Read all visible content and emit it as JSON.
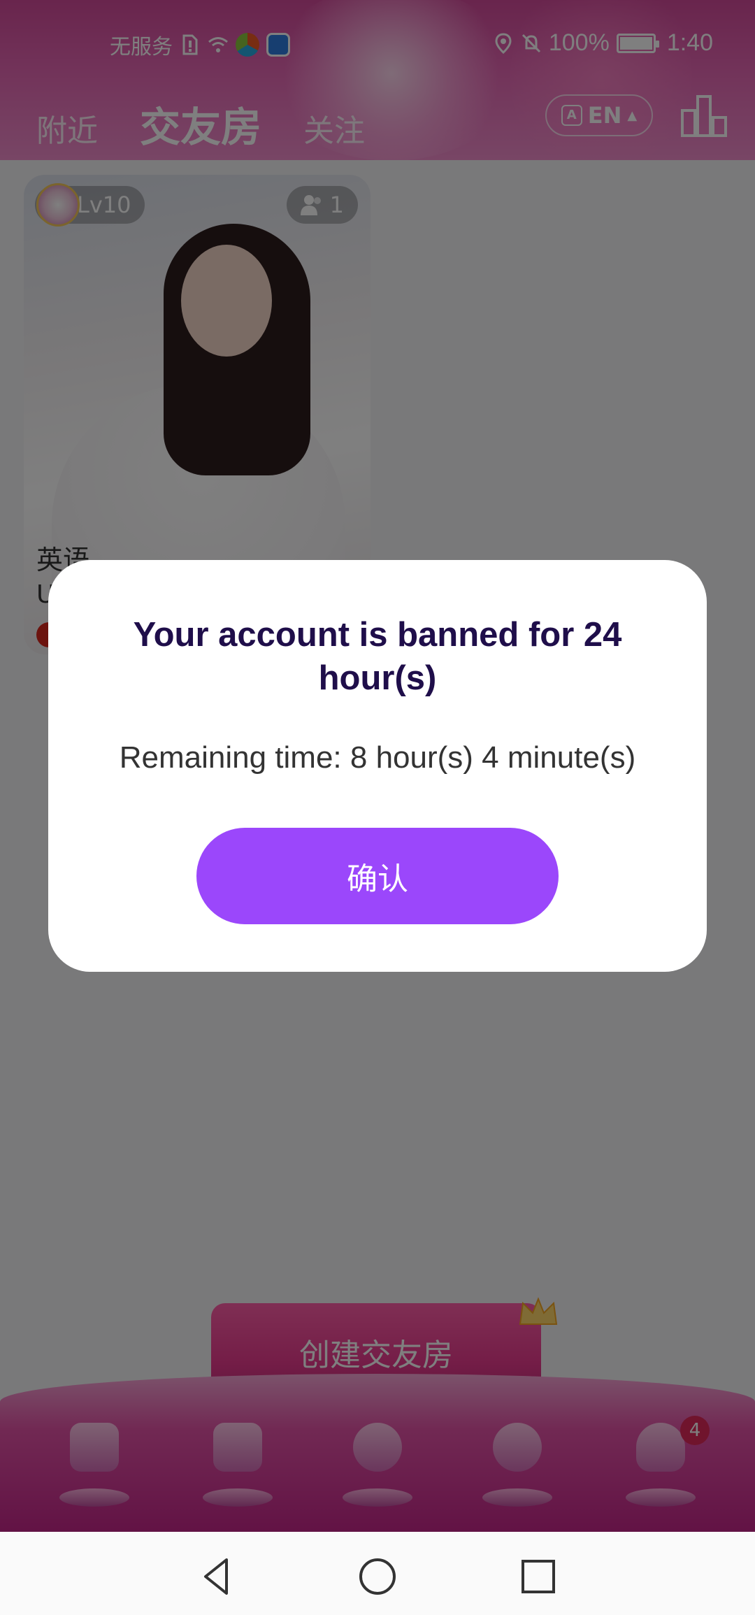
{
  "status_bar": {
    "carrier": "无服务",
    "battery": "100%",
    "time": "1:40"
  },
  "header": {
    "tabs": [
      {
        "label": "附近",
        "active": false
      },
      {
        "label": "交友房",
        "active": true
      },
      {
        "label": "关注",
        "active": false
      }
    ],
    "language_button": "EN",
    "ranking_icon": "bar-chart-icon"
  },
  "room_card": {
    "level": "Lv10",
    "member_count": "1",
    "title": "英语",
    "subtitle": "U"
  },
  "create_room_button": "创建交友房",
  "bottom_nav": {
    "items": [
      {
        "icon": "video-heart-icon"
      },
      {
        "icon": "tv-heart-icon"
      },
      {
        "icon": "chat-room-icon"
      },
      {
        "icon": "planet-heart-icon"
      },
      {
        "icon": "octopus-icon",
        "badge": "4"
      }
    ]
  },
  "dialog": {
    "title": "Your account is banned for 24 hour(s)",
    "message": "Remaining time: 8 hour(s) 4 minute(s)",
    "confirm_label": "确认"
  },
  "colors": {
    "header_pink": "#e567b4",
    "dialog_button": "#9b47fb",
    "dialog_title": "#1f0e4a"
  }
}
